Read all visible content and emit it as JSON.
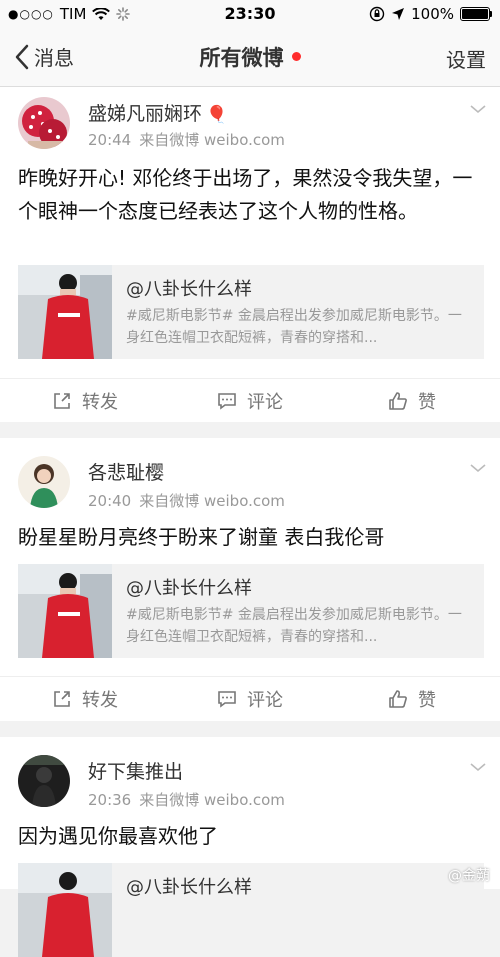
{
  "status_bar": {
    "carrier": "TIM",
    "signal_dots": "●○○○",
    "time": "23:30",
    "battery": "100%"
  },
  "nav": {
    "back_label": "消息",
    "title": "所有微博",
    "settings_label": "设置"
  },
  "posts": [
    {
      "user": "盛娣凡丽娴环",
      "time": "20:44",
      "source": "来自微博 weibo.com",
      "text": "昨晚好开心! 邓伦终于出场了，果然没令我失望，一个眼神一个态度已经表达了这个人物的性格。",
      "card": {
        "title": "@八卦长什么样",
        "desc": "#威尼斯电影节# 金晨启程出发参加威尼斯电影节。一身红色连帽卫衣配短裤，青春的穿搭和..."
      },
      "actions": {
        "repost": "转发",
        "comment": "评论",
        "like": "赞"
      }
    },
    {
      "user": "各悲耻樱",
      "time": "20:40",
      "source": "来自微博 weibo.com",
      "text": "盼星星盼月亮终于盼来了谢童 表白我伦哥",
      "card": {
        "title": "@八卦长什么样",
        "desc": "#威尼斯电影节# 金晨启程出发参加威尼斯电影节。一身红色连帽卫衣配短裤，青春的穿搭和..."
      },
      "actions": {
        "repost": "转发",
        "comment": "评论",
        "like": "赞"
      }
    },
    {
      "user": "好下集推出",
      "time": "20:36",
      "source": "来自微博 weibo.com",
      "text": "因为遇见你最喜欢他了",
      "card": {
        "title": "@八卦长什么样"
      }
    }
  ],
  "watermark": "@金蒴",
  "colors": {
    "background": "#f2f2f2",
    "card_background": "#f2f2f2",
    "red_dot": "#ff2d2d",
    "meta_text": "#999999"
  }
}
